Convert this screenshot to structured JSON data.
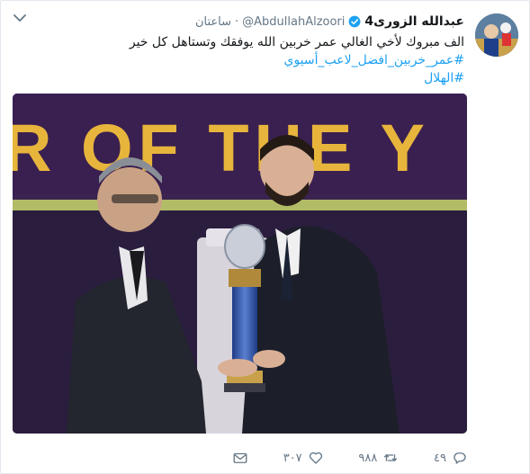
{
  "author": {
    "display_name": "عبدالله الزورى4",
    "handle": "@AbdullahAlzoori",
    "separator": "·",
    "time": "ساعتان",
    "verified": true
  },
  "tweet": {
    "text": "الف مبروك لأخي الغالي عمر خربين الله يوفقك وتستاهل كل خير",
    "hashtags": [
      "#عمر_خربين_افضل_لاعب_أسيوي",
      "#الهلال"
    ]
  },
  "media": {
    "banner_text": "R OF THE Y"
  },
  "actions": {
    "mail_icon": "mail-icon",
    "likes": "٣٠٧",
    "like_icon": "heart-icon",
    "retweets": "٩٨٨",
    "retweet_icon": "retweet-icon",
    "replies": "٤٩",
    "reply_icon": "reply-icon"
  },
  "colors": {
    "link": "#1da1f2",
    "muted": "#657786",
    "text": "#14171a",
    "verified": "#1da1f2"
  }
}
